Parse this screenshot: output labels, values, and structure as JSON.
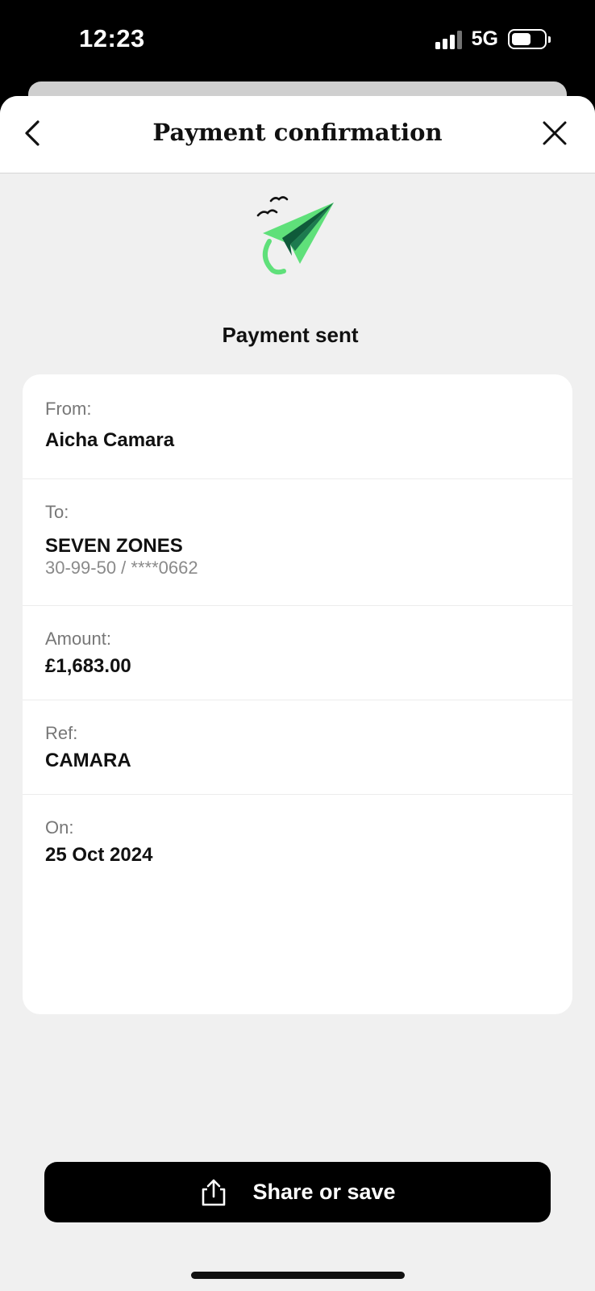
{
  "status_bar": {
    "time": "12:23",
    "network": "5G",
    "battery_level": 0.6
  },
  "header": {
    "title": "Payment confirmation",
    "back_icon": "chevron-left-icon",
    "close_icon": "close-icon"
  },
  "illustration_icon": "paper-plane-icon",
  "status_title": "Payment sent",
  "details": {
    "from_label": "From:",
    "from_value": "Aicha Camara",
    "to_label": "To:",
    "to_value": "SEVEN ZONES",
    "to_account": "30-99-50 / ****0662",
    "amount_label": "Amount:",
    "amount_value": "£1,683.00",
    "ref_label": "Ref:",
    "ref_value": "CAMARA",
    "on_label": "On:",
    "on_value": "25 Oct 2024"
  },
  "actions": {
    "share_label": "Share or save",
    "share_icon": "share-icon"
  },
  "colors": {
    "accent_green": "#5fe07a",
    "dark_green": "#0f5a3a",
    "button_bg": "#000000",
    "sheet_bg": "#f0f0f0"
  }
}
